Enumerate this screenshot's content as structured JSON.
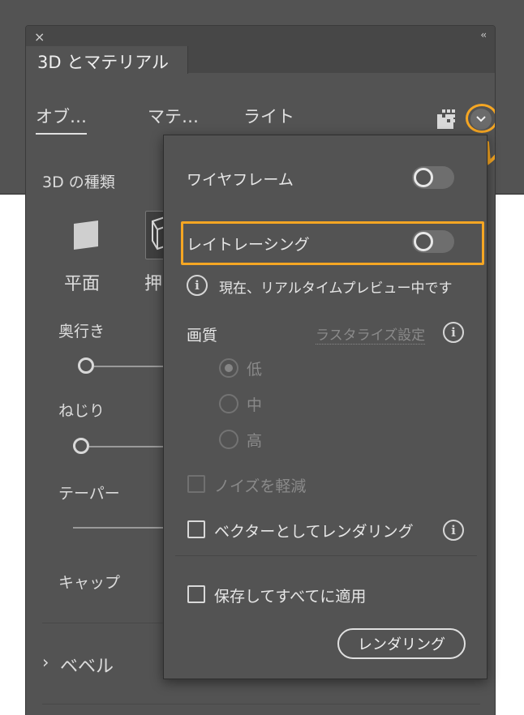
{
  "panel": {
    "title": "3D とマテリアル",
    "close_glyph": "×",
    "collapse_glyph": "‹‹",
    "tabs": [
      {
        "label": "オブ…",
        "active": true
      },
      {
        "label": "マテ…",
        "active": false
      },
      {
        "label": "ライト",
        "active": false
      }
    ],
    "type_label": "3D の種類",
    "types": [
      {
        "label": "平面"
      },
      {
        "label": "押"
      }
    ],
    "depth_label": "奥行き",
    "twist_label": "ねじり",
    "taper_label": "テーパー",
    "cap_label": "キャップ",
    "bevel_label": "ベベル",
    "bevel_chevron": "›"
  },
  "annotation": {
    "color": "#f5a623"
  },
  "popup": {
    "wireframe_label": "ワイヤフレーム",
    "raytracing_label": "レイトレーシング",
    "preview_info": "現在、リアルタイムプレビュー中です",
    "quality_label": "画質",
    "rasterize_link": "ラスタライズ設定",
    "quality_options": [
      {
        "label": "低",
        "checked": true
      },
      {
        "label": "中",
        "checked": false
      },
      {
        "label": "高",
        "checked": false
      }
    ],
    "noise_label": "ノイズを軽減",
    "vector_label": "ベクターとしてレンダリング",
    "save_label": "保存してすべてに適用",
    "render_button": "レンダリング",
    "info_glyph": "i"
  }
}
